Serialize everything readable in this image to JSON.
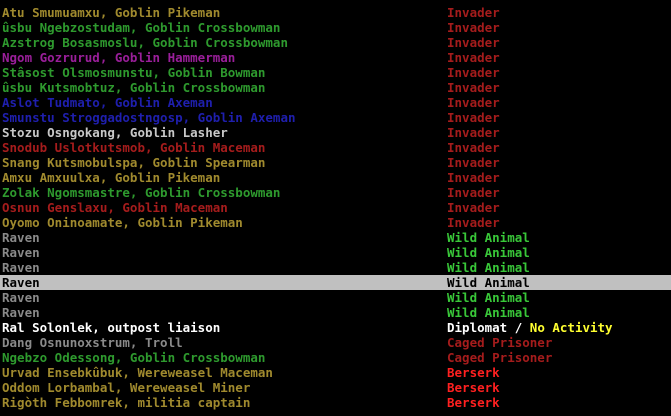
{
  "colors": {
    "brown": "#a08a2e",
    "green": "#2e9a2e",
    "bright_green": "#39c739",
    "magenta": "#9a1f9a",
    "blue": "#1f1fae",
    "white": "#ffffff",
    "light_gray": "#c8c8c8",
    "gray": "#8a8a8a",
    "dark_red": "#a51c1c",
    "red": "#ff2020",
    "yellow": "#ffff30",
    "selected_bg": "#c0c0c0"
  },
  "units": [
    {
      "name": "Atu Smumuamxu, Goblin Pikeman",
      "name_color": "brown",
      "status": "Invader",
      "status_color": "dark_red"
    },
    {
      "name": "ûsbu Ngebzostudam, Goblin Crossbowman",
      "name_color": "green",
      "status": "Invader",
      "status_color": "dark_red"
    },
    {
      "name": "Azstrog Bosasmoslu, Goblin Crossbowman",
      "name_color": "green",
      "status": "Invader",
      "status_color": "dark_red"
    },
    {
      "name": "Ngom Gozrurud, Goblin Hammerman",
      "name_color": "magenta",
      "status": "Invader",
      "status_color": "dark_red"
    },
    {
      "name": "Stâsost Olsmosmunstu, Goblin Bowman",
      "name_color": "green",
      "status": "Invader",
      "status_color": "dark_red"
    },
    {
      "name": "ûsbu Kutsmobtuz, Goblin Crossbowman",
      "name_color": "green",
      "status": "Invader",
      "status_color": "dark_red"
    },
    {
      "name": "Aslot Tudmato, Goblin Axeman",
      "name_color": "blue",
      "status": "Invader",
      "status_color": "dark_red"
    },
    {
      "name": "Smunstu Stroggadostngosp, Goblin Axeman",
      "name_color": "blue",
      "status": "Invader",
      "status_color": "dark_red"
    },
    {
      "name": "Stozu Osngokang, Goblin Lasher",
      "name_color": "light_gray",
      "status": "Invader",
      "status_color": "dark_red"
    },
    {
      "name": "Snodub Uslotkutsmob, Goblin Maceman",
      "name_color": "dark_red",
      "status": "Invader",
      "status_color": "dark_red"
    },
    {
      "name": "Snang Kutsmobulspa, Goblin Spearman",
      "name_color": "brown",
      "status": "Invader",
      "status_color": "dark_red"
    },
    {
      "name": "Amxu Amxuulxa, Goblin Pikeman",
      "name_color": "brown",
      "status": "Invader",
      "status_color": "dark_red"
    },
    {
      "name": "Zolak Ngomsmastre, Goblin Crossbowman",
      "name_color": "green",
      "status": "Invader",
      "status_color": "dark_red"
    },
    {
      "name": "Osnun Genslaxu, Goblin Maceman",
      "name_color": "dark_red",
      "status": "Invader",
      "status_color": "dark_red"
    },
    {
      "name": "Oyomo Oninoamate, Goblin Pikeman",
      "name_color": "brown",
      "status": "Invader",
      "status_color": "dark_red"
    },
    {
      "name": "Raven",
      "name_color": "gray",
      "status": "Wild Animal",
      "status_color": "bright_green"
    },
    {
      "name": "Raven",
      "name_color": "gray",
      "status": "Wild Animal",
      "status_color": "bright_green"
    },
    {
      "name": "Raven",
      "name_color": "gray",
      "status": "Wild Animal",
      "status_color": "bright_green"
    },
    {
      "name": "Raven",
      "name_color": "gray",
      "status": "Wild Animal",
      "status_color": "bright_green",
      "selected": true
    },
    {
      "name": "Raven",
      "name_color": "gray",
      "status": "Wild Animal",
      "status_color": "bright_green"
    },
    {
      "name": "Raven",
      "name_color": "gray",
      "status": "Wild Animal",
      "status_color": "bright_green"
    },
    {
      "name": "Ral Solonlek, outpost liaison",
      "name_color": "white",
      "status": "Diplomat / ",
      "status_color": "white",
      "status_extra": "No Activity",
      "status_extra_color": "yellow"
    },
    {
      "name": "Dang Osnunoxstrum, Troll",
      "name_color": "gray",
      "status": "Caged Prisoner",
      "status_color": "dark_red"
    },
    {
      "name": "Ngebzo Odessong, Goblin Crossbowman",
      "name_color": "green",
      "status": "Caged Prisoner",
      "status_color": "dark_red"
    },
    {
      "name": "Urvad Ensebkûbuk, Wereweasel Maceman",
      "name_color": "brown",
      "status": "Berserk",
      "status_color": "red"
    },
    {
      "name": "Oddom Lorbambal, Wereweasel Miner",
      "name_color": "brown",
      "status": "Berserk",
      "status_color": "red"
    },
    {
      "name": "Rigòth Febbomrek, militia captain",
      "name_color": "brown",
      "status": "Berserk",
      "status_color": "red"
    }
  ]
}
